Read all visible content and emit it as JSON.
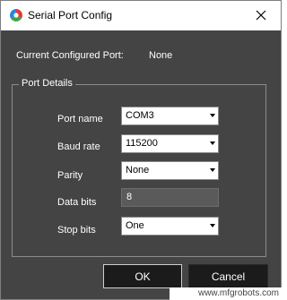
{
  "window": {
    "title": "Serial Port Config",
    "icon": "app-logo-icon",
    "close_icon": "close-icon"
  },
  "current_port": {
    "label": "Current Configured Port:",
    "value": "None"
  },
  "port_details": {
    "legend": "Port Details",
    "fields": {
      "port_name": {
        "label": "Port name",
        "value": "COM3"
      },
      "baud_rate": {
        "label": "Baud rate",
        "value": "115200"
      },
      "parity": {
        "label": "Parity",
        "value": "None"
      },
      "data_bits": {
        "label": "Data bits",
        "value": "8"
      },
      "stop_bits": {
        "label": "Stop bits",
        "value": "One"
      }
    }
  },
  "buttons": {
    "ok": "OK",
    "cancel": "Cancel"
  },
  "watermark": "www.mfgrobots.com",
  "colors": {
    "dialog_bg": "#444444",
    "titlebar_bg": "#ffffff",
    "button_bg": "#1b1b1b",
    "text": "#ffffff"
  }
}
